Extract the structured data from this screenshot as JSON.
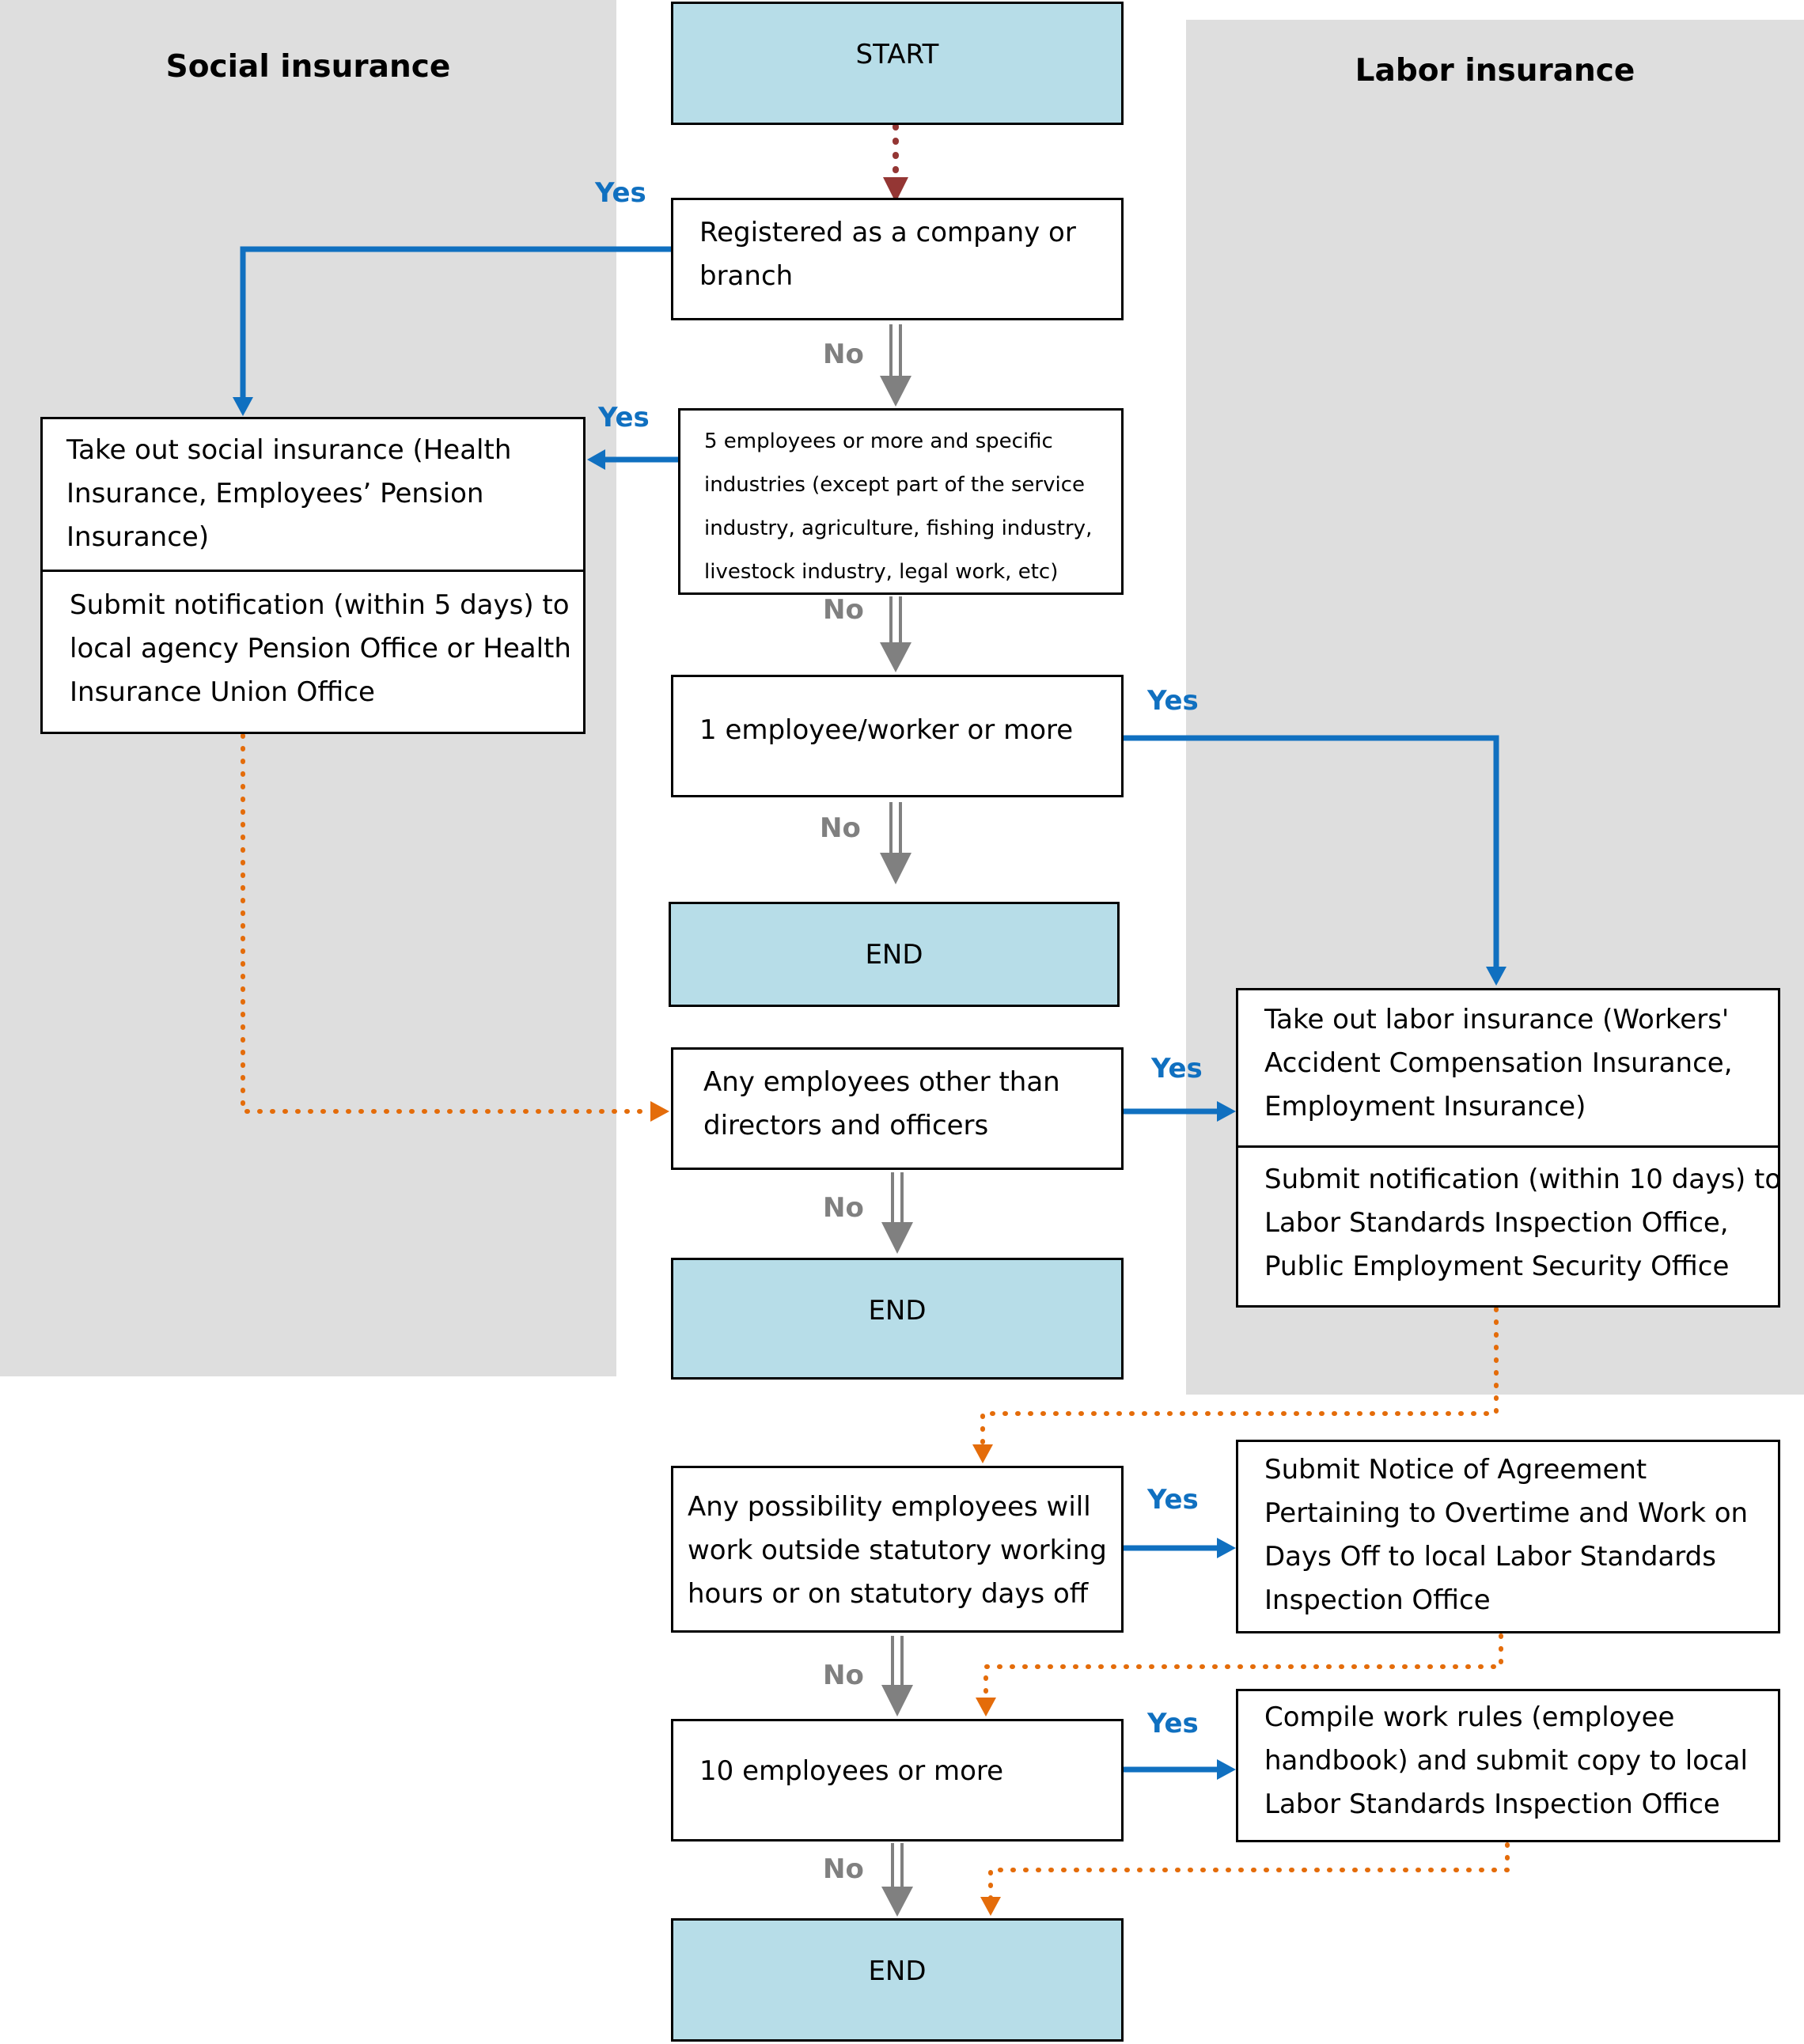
{
  "lanes": {
    "social": {
      "title": "Social insurance"
    },
    "labor": {
      "title": "Labor insurance"
    }
  },
  "nodes": {
    "start": "START",
    "registered": [
      "Registered as a company or",
      "branch"
    ],
    "five_employees": [
      "5 employees or more and specific",
      "industries (except part of the service",
      "industry, agriculture, fishing industry,",
      "livestock industry, legal work, etc)"
    ],
    "one_employee": [
      "1 employee/worker or more"
    ],
    "end1": "END",
    "other_than_directors": [
      "Any employees other than",
      "directors and officers"
    ],
    "end2": "END",
    "social_take_out": [
      "Take out social insurance (Health",
      "Insurance, Employees’ Pension",
      "Insurance)"
    ],
    "social_submit": [
      "Submit notification (within 5 days) to",
      "local agency Pension Office or Health",
      "Insurance Union Office"
    ],
    "labor_take_out": [
      "Take out labor insurance (Workers'",
      "Accident Compensation Insurance,",
      "Employment Insurance)"
    ],
    "labor_submit": [
      "Submit notification (within 10 days) to",
      "Labor Standards Inspection Office,",
      "Public Employment Security Office"
    ],
    "overtime_question": [
      "Any possibility employees will",
      "work outside statutory working",
      "hours or on statutory days off"
    ],
    "notice_agreement": [
      "Submit Notice of Agreement",
      "Pertaining to Overtime and Work on",
      "Days Off to local Labor Standards",
      "Inspection Office"
    ],
    "ten_employees": [
      "10 employees or more"
    ],
    "work_rules": [
      "Compile work rules (employee",
      "handbook) and submit copy to local",
      "Labor Standards Inspection Office"
    ],
    "end3": "END"
  },
  "labels": {
    "yes": "Yes",
    "no": "No"
  },
  "colors": {
    "lane_bg": "#dedede",
    "terminal_fill": "#b7dde8",
    "yes_blue": "#1070c0",
    "no_gray": "#808080",
    "dotted_orange": "#e46c0a",
    "start_dotted": "#943634"
  }
}
